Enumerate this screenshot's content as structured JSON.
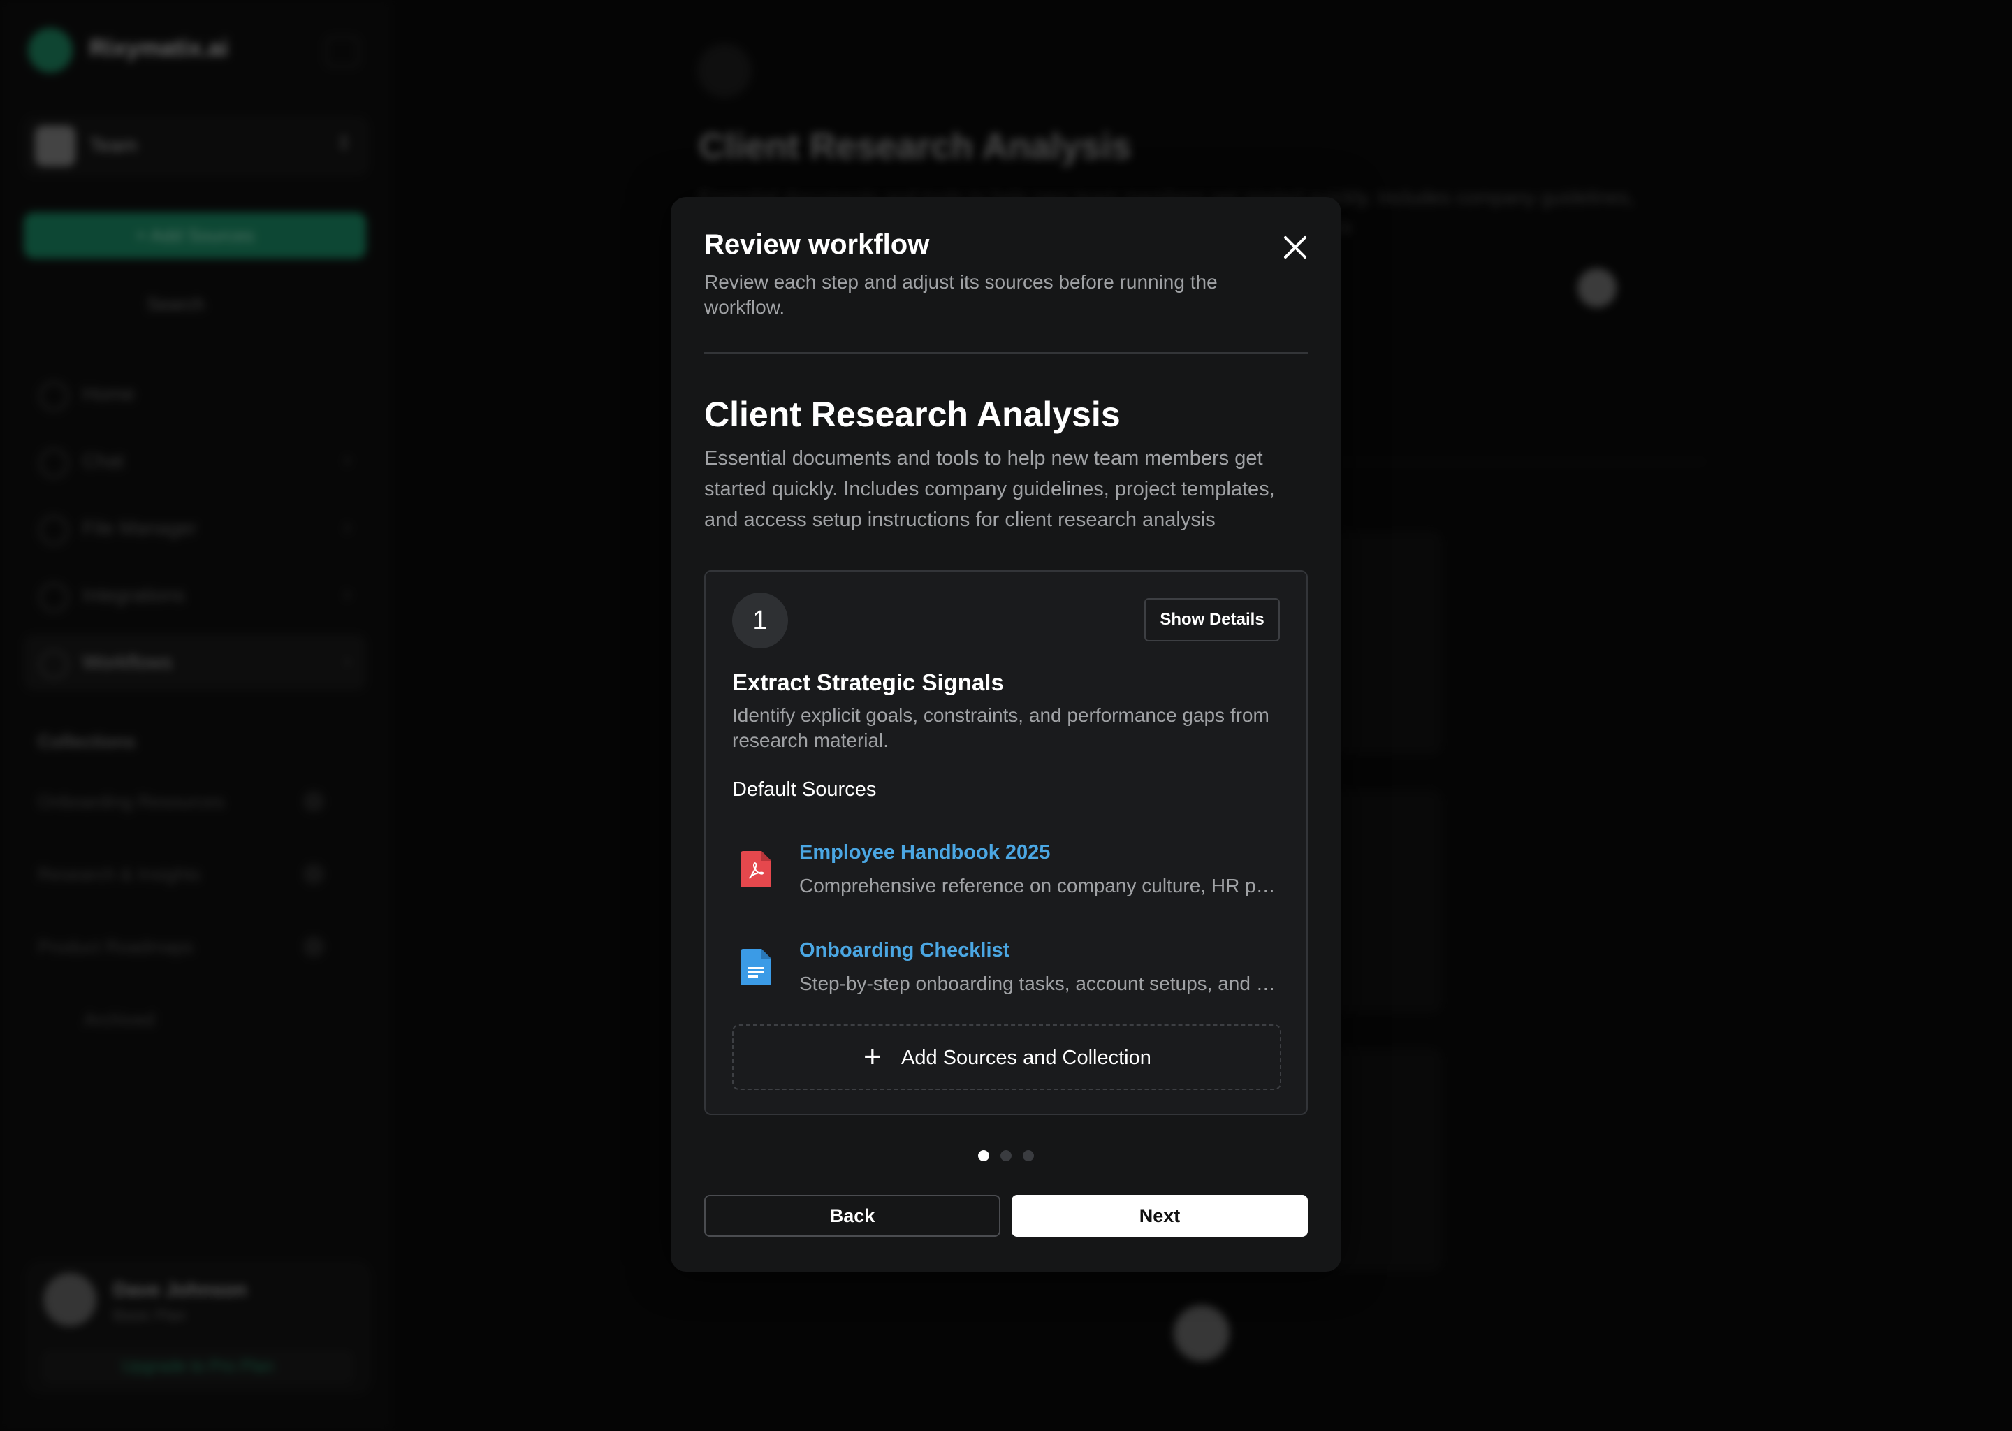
{
  "background": {
    "brand": "Rixymatix.ai",
    "team": "Team",
    "add_button": "+  Add Sources",
    "search": "Search",
    "nav": [
      {
        "label": "Home"
      },
      {
        "label": "Chat"
      },
      {
        "label": "File Manager"
      },
      {
        "label": "Integrations"
      },
      {
        "label": "Workflows"
      }
    ],
    "collections_label": "Collections",
    "collections": [
      {
        "label": "Onboarding Resources"
      },
      {
        "label": "Research & Insights"
      },
      {
        "label": "Product Roadmaps"
      },
      {
        "label": "Archived"
      }
    ],
    "user": {
      "name": "Dave Johnson",
      "plan": "Basic Plan",
      "upgrade": "Upgrade to Pro Plan"
    },
    "page_title": "Client Research Analysis",
    "page_desc": "Essential documents and tools to help new team members get started quickly. Includes company guidelines, project templates, and access setup instructions for client research analysis"
  },
  "modal": {
    "title": "Review workflow",
    "subtitle": "Review each step and adjust its sources before running the workflow.",
    "workflow_title": "Client Research Analysis",
    "workflow_desc": "Essential documents and tools to help new team members get started quickly. Includes company guidelines, project templates, and access setup instructions for client research analysis",
    "step": {
      "number": "1",
      "show_details": "Show Details",
      "title": "Extract Strategic Signals",
      "desc": "Identify explicit goals, constraints, and performance gaps from research material.",
      "sources_heading": "Default Sources",
      "sources": [
        {
          "name": "Employee Handbook 2025",
          "desc": "Comprehensive reference on company culture, HR policies and benefits",
          "icon": "pdf-file-icon",
          "color": "#e5484d"
        },
        {
          "name": "Onboarding Checklist",
          "desc": "Step-by-step onboarding tasks, account setups, and access requests",
          "icon": "doc-file-icon",
          "color": "#3b9be6"
        }
      ],
      "add_sources": "Add Sources and Collection"
    },
    "pagination": {
      "current": 1,
      "total": 3
    },
    "back": "Back",
    "next": "Next"
  },
  "colors": {
    "accent": "#1b8f68",
    "link": "#4ba7e3",
    "modal_bg": "#151617"
  }
}
